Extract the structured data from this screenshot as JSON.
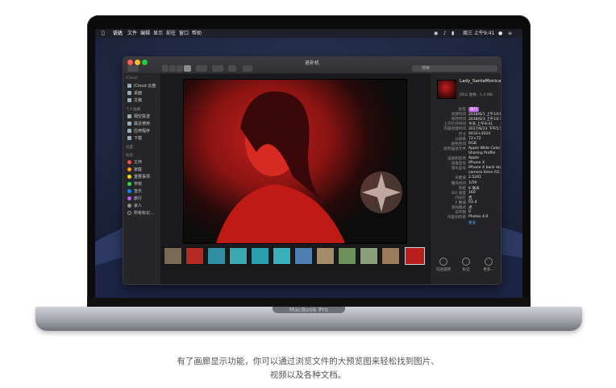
{
  "device": {
    "brand_label": "MacBook Pro"
  },
  "menubar": {
    "items": [
      "访达",
      "文件",
      "编辑",
      "显示",
      "前往",
      "窗口",
      "帮助"
    ],
    "clock": "周三 上午9:41"
  },
  "finder": {
    "window_title": "退补机",
    "search_placeholder": "搜索",
    "sidebar": {
      "section_icloud": "iCloud",
      "icloud_items": [
        "iCloud 云盘",
        "桌面",
        "文稿"
      ],
      "section_personal": "个人收藏",
      "personal_items": [
        "隔空投送",
        "最近使用",
        "应用程序",
        "下载"
      ],
      "section_location": "位置",
      "section_tags": "标签",
      "tags": [
        {
          "label": "工作",
          "color": "#ff4a45"
        },
        {
          "label": "家庭",
          "color": "#ff9d0a"
        },
        {
          "label": "重要事项",
          "color": "#ffd60a"
        },
        {
          "label": "学校",
          "color": "#32d74b"
        },
        {
          "label": "音乐",
          "color": "#0a84ff"
        },
        {
          "label": "旅行",
          "color": "#bf5af2"
        },
        {
          "label": "家人",
          "color": "#8e8e93"
        }
      ],
      "all_tags": "所有标记..."
    },
    "info": {
      "filename": "Lady_SantaMonicaPier.jpeg",
      "kind": "JPEG 图像 - 1.4 MB",
      "rows": [
        {
          "k": "标签",
          "v": "旅行"
        },
        {
          "k": "创建时间",
          "v": "2018/6/1 上午10:09"
        },
        {
          "k": "修改时间",
          "v": "2018/6/3 上午10:13"
        },
        {
          "k": "上次打开时间",
          "v": "今天 上午9:41"
        },
        {
          "k": "内容创建时间",
          "v": "2017/6/23 下午5:16"
        },
        {
          "k": "尺寸",
          "v": "4032×3024"
        },
        {
          "k": "分辨率",
          "v": "72×72"
        },
        {
          "k": "颜色空间",
          "v": "RGB"
        },
        {
          "k": "颜色描述文件",
          "v": "Apple Wide Color"
        },
        {
          "k": "",
          "v": "Sharing Profile"
        },
        {
          "k": "设备制造商",
          "v": "Apple"
        },
        {
          "k": "设备型号",
          "v": "iPhone X"
        },
        {
          "k": "镜头型号",
          "v": "iPhone X back dual"
        },
        {
          "k": "",
          "v": "camera 6mm f/2.4"
        },
        {
          "k": "光圈值",
          "v": "2.5261"
        },
        {
          "k": "曝光时间",
          "v": "1/59"
        },
        {
          "k": "焦距",
          "v": "6 毫米"
        },
        {
          "k": "ISO 速度",
          "v": "160"
        },
        {
          "k": "闪光灯",
          "v": "否"
        },
        {
          "k": "F 数值",
          "v": "f/2.4"
        },
        {
          "k": "测光模式",
          "v": "点"
        },
        {
          "k": "白平衡",
          "v": "0"
        },
        {
          "k": "内容创作者",
          "v": "Photos 4.0"
        }
      ],
      "more_link": "更多",
      "actions": [
        "向左旋转",
        "标记",
        "更多..."
      ]
    }
  },
  "caption": {
    "line1": "有了画廊显示功能，你可以通过浏览文件的大预览图来轻松找到图片、",
    "line2": "视频以及各种文档。"
  }
}
